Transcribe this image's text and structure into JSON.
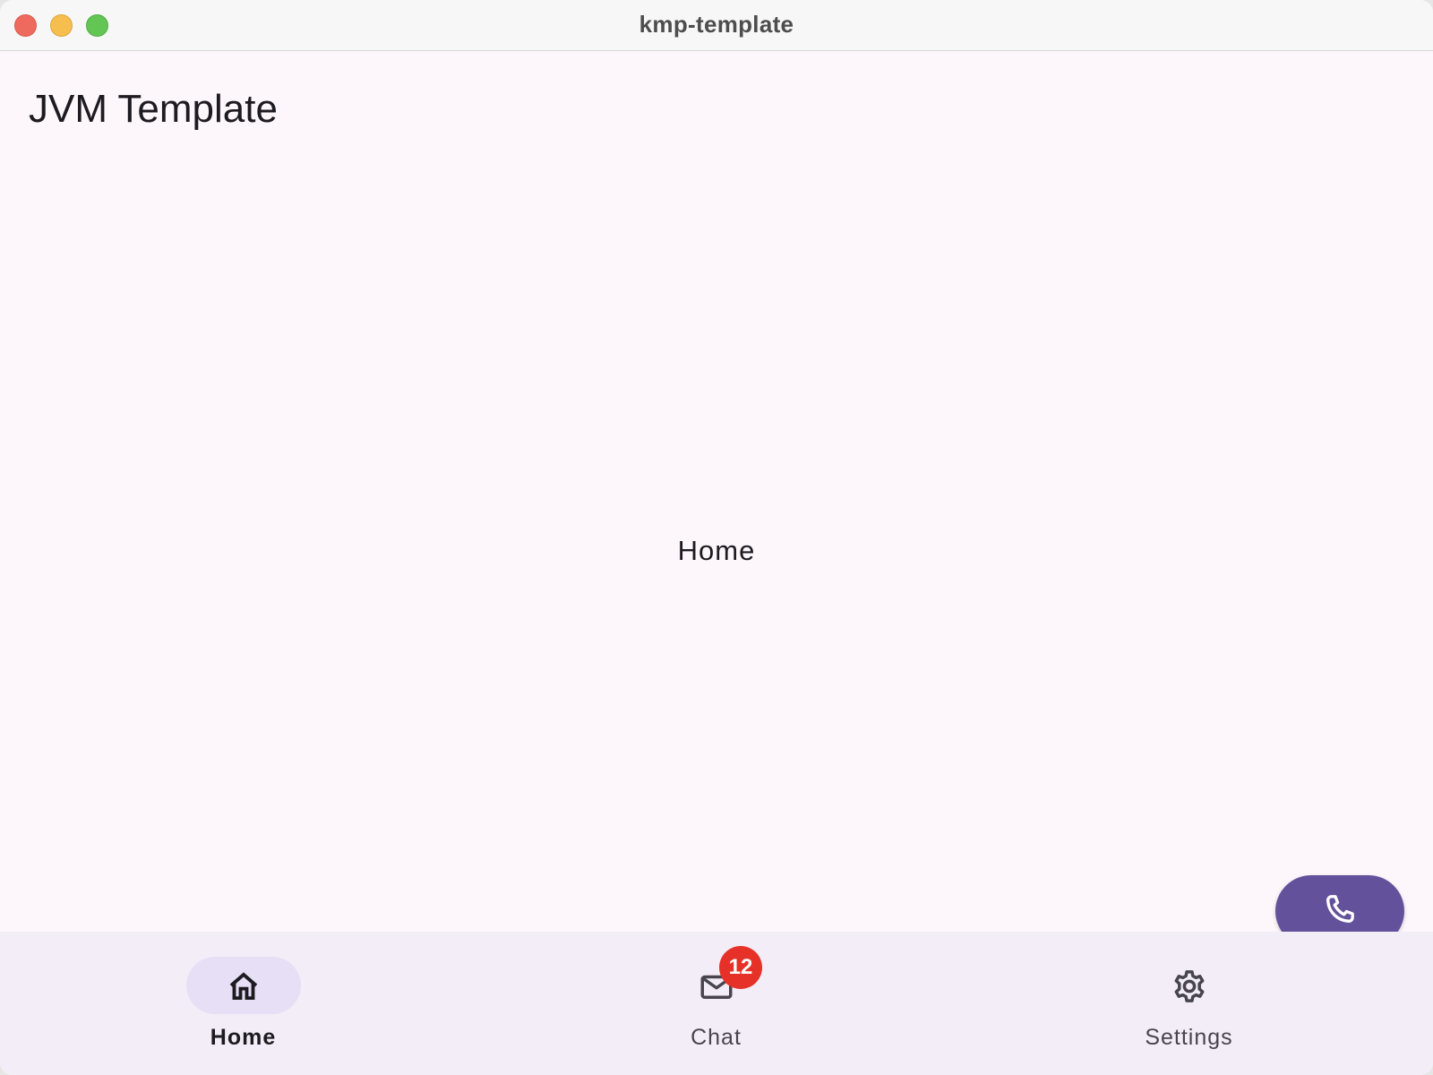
{
  "window": {
    "title": "kmp-template"
  },
  "app": {
    "title": "JVM Template",
    "screen_text": "Home"
  },
  "fab": {
    "icon": "phone-icon",
    "color": "#63519b"
  },
  "bottom_nav": {
    "items": [
      {
        "label": "Home",
        "icon": "home-icon",
        "selected": true
      },
      {
        "label": "Chat",
        "icon": "mail-icon",
        "selected": false,
        "badge": "12"
      },
      {
        "label": "Settings",
        "icon": "gear-icon",
        "selected": false
      }
    ]
  },
  "colors": {
    "background": "#fdf7fc",
    "nav_background": "#f3edf7",
    "indicator": "#e7dff6",
    "badge": "#e53127",
    "text": "#1d1b20"
  }
}
